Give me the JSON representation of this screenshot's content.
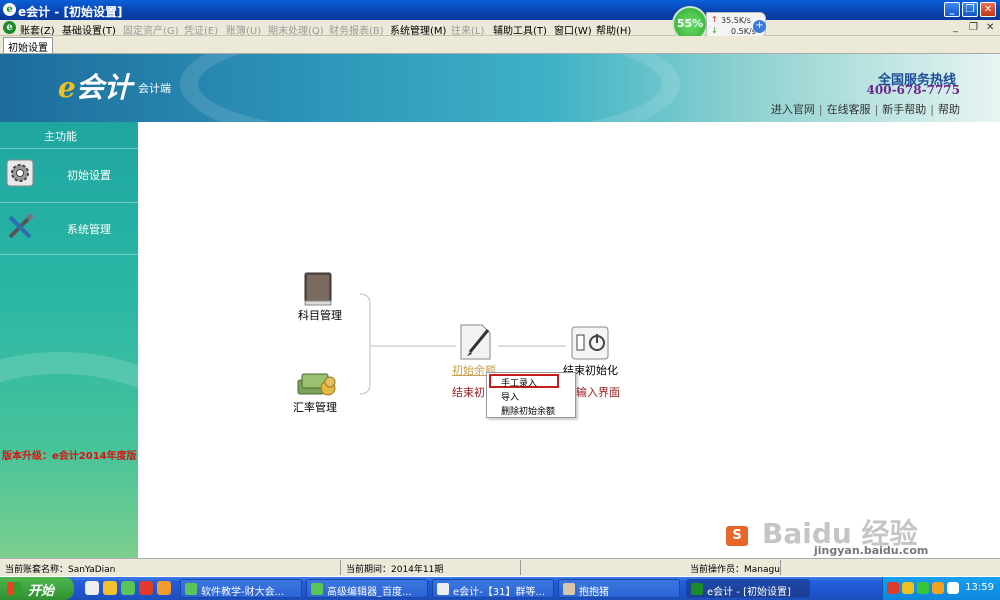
{
  "window": {
    "app_icon": "e",
    "title": "e会计 - [初始设置]",
    "minimize": "_",
    "restore": "❐",
    "close": "✕"
  },
  "menubar": {
    "items": [
      {
        "label": "账套(Z)",
        "enabled": true
      },
      {
        "label": "基础设置(T)",
        "enabled": true
      },
      {
        "label": "固定资产(G)",
        "enabled": false
      },
      {
        "label": "凭证(E)",
        "enabled": false
      },
      {
        "label": "账簿(U)",
        "enabled": false
      },
      {
        "label": "期末处理(Q)",
        "enabled": false
      },
      {
        "label": "财务报表(B)",
        "enabled": false
      },
      {
        "label": "系统管理(M)",
        "enabled": true
      },
      {
        "label": "往来(L)",
        "enabled": false
      },
      {
        "label": "辅助工具(T)",
        "enabled": true
      },
      {
        "label": "窗口(W)",
        "enabled": true
      },
      {
        "label": "帮助(H)",
        "enabled": true
      }
    ],
    "mdi_min": "_",
    "mdi_restore": "❐",
    "mdi_close": "✕"
  },
  "net_monitor": {
    "percent": "55%",
    "up": "35.5K/s",
    "down": "0.5K/s"
  },
  "tab": {
    "label": "初始设置"
  },
  "banner": {
    "logo_e": "e",
    "logo_text": "会计",
    "subtitle": "会计端",
    "hotline_label": "全国服务热线",
    "hotline_number": "400-678-7775",
    "links": [
      "进入官网",
      "在线客服",
      "新手帮助",
      "帮助"
    ],
    "link_sep": "|"
  },
  "sidebar": {
    "title": "主功能",
    "items": [
      {
        "label": "初始设置",
        "icon": "gear-icon"
      },
      {
        "label": "系统管理",
        "icon": "tools-icon"
      }
    ],
    "upgrade_notice": "版本升级：e会计2014年度版"
  },
  "flow": {
    "nodes": [
      {
        "label": "科目管理",
        "icon": "book-icon"
      },
      {
        "label": "汇率管理",
        "icon": "money-icon"
      },
      {
        "label": "初始余额",
        "icon": "document-pen-icon"
      },
      {
        "label": "结束初始化",
        "icon": "power-switch-icon"
      }
    ],
    "caption_left": "结束初",
    "caption_right": "输入界面"
  },
  "context_menu": {
    "items": [
      "手工录入",
      "导入",
      "删除初始余额"
    ],
    "highlighted_index": 0
  },
  "statusbar": {
    "account": "当前账套名称：SanYaDian",
    "period": "当前期间：2014年11期",
    "operator": "当前操作员：Managu"
  },
  "taskbar": {
    "start": "开始",
    "tasks": [
      {
        "label": "软件教学-财大会..."
      },
      {
        "label": "高级编辑器_百度..."
      },
      {
        "label": "e会计-【31】群等..."
      },
      {
        "label": "抱抱猪"
      },
      {
        "label": "e会计 - [初始设置]"
      }
    ],
    "clock": "13:59"
  },
  "watermark": {
    "text": "Baidu 经验",
    "url": "jingyan.baidu.com"
  },
  "colors": {
    "title_bar": "#0a4fc4",
    "sidebar": "#2bb7a5",
    "context_highlight": "#c41e1e",
    "upgrade_text": "#dd1111",
    "flow_link": "#c8a050",
    "flow_red": "#9a1a1a"
  }
}
